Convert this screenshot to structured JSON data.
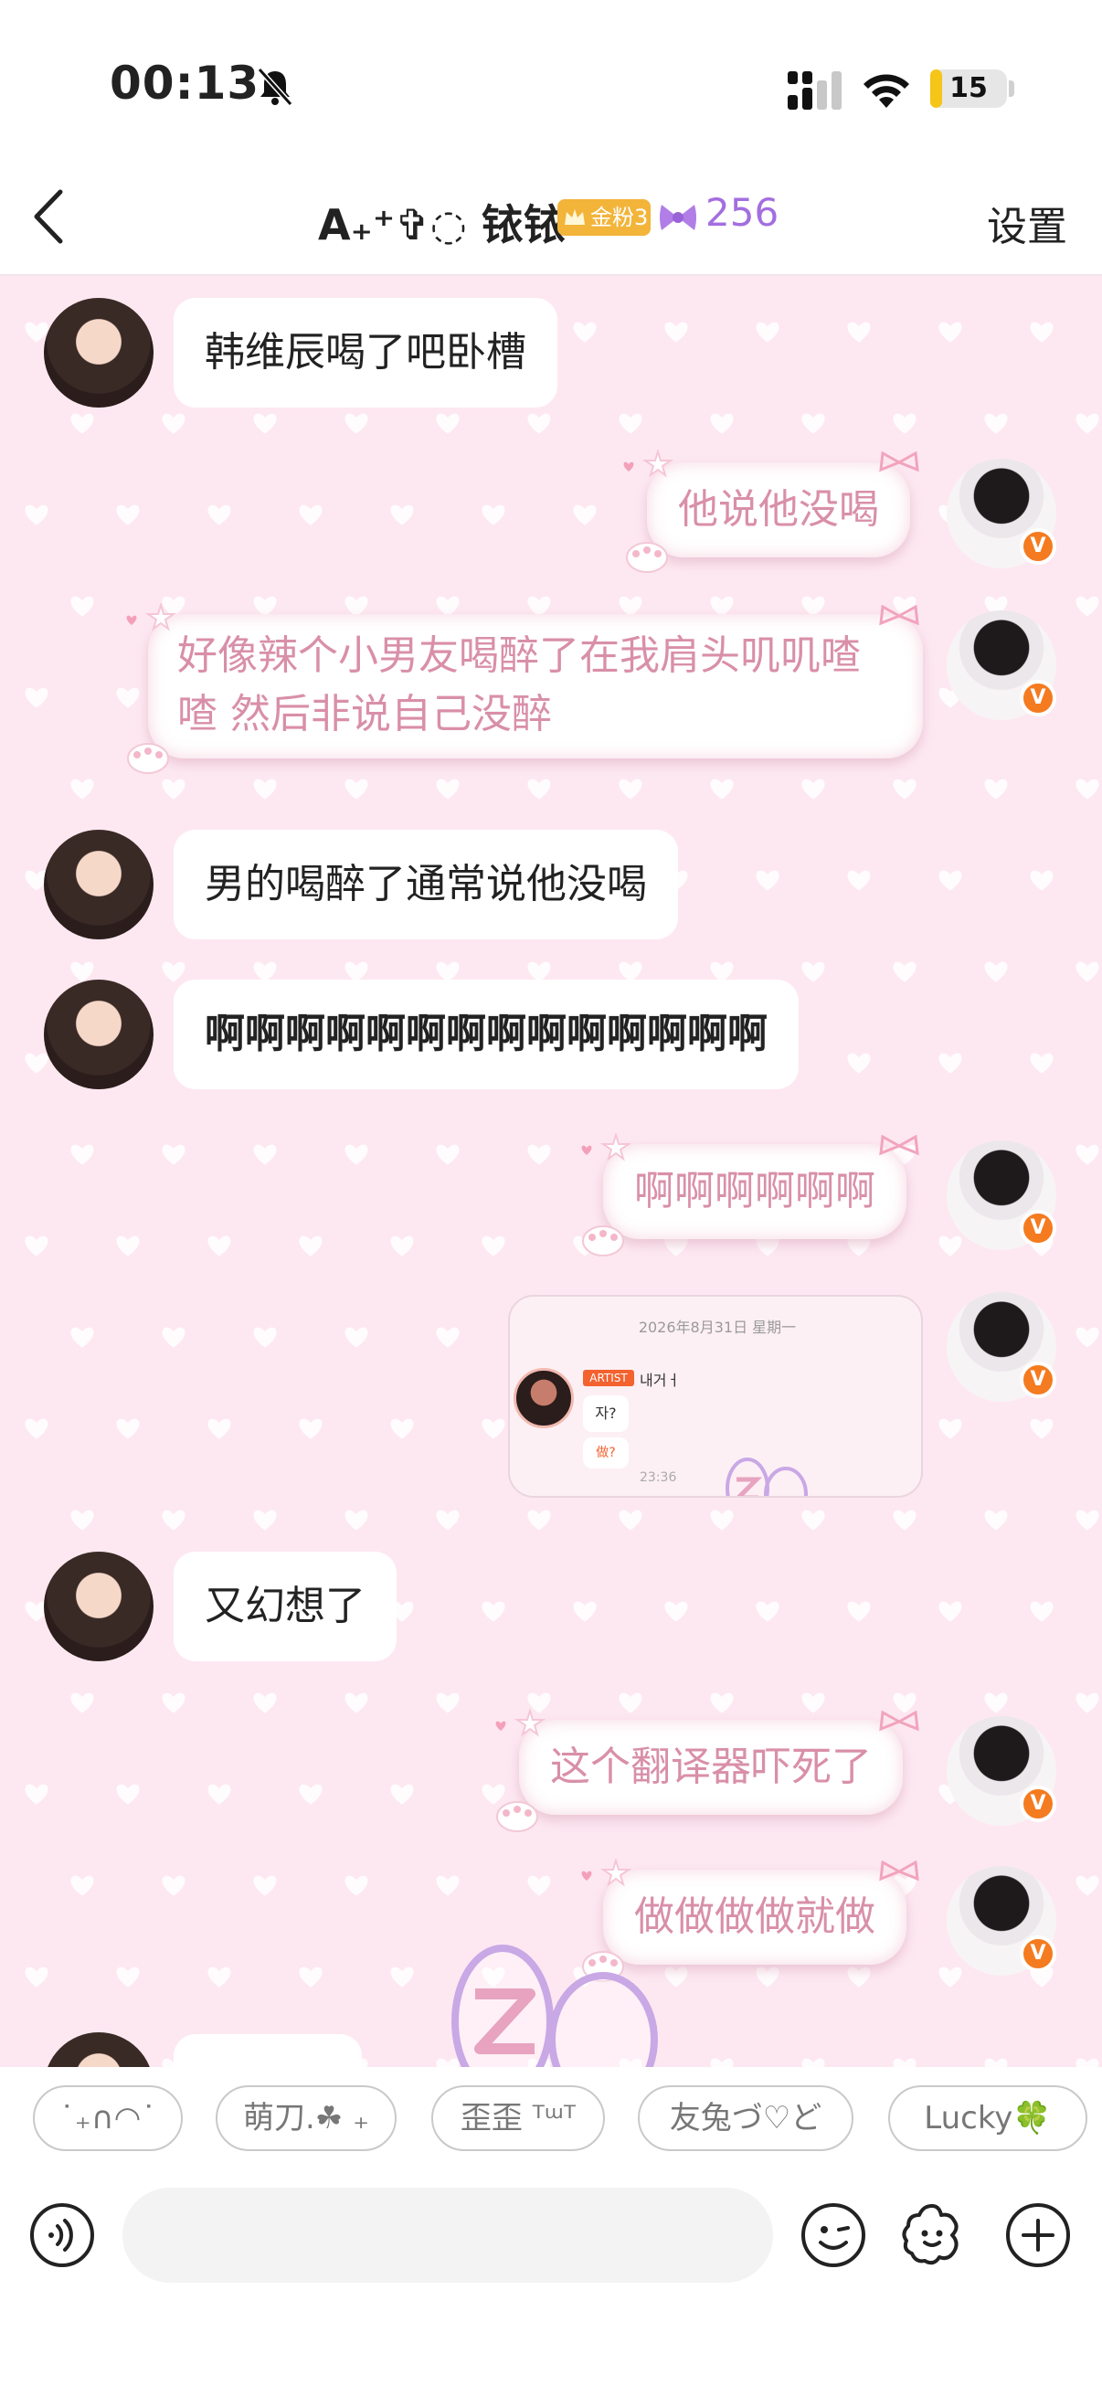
{
  "status_bar": {
    "time": "00:13",
    "battery": "15",
    "battery_level": 0.15,
    "icons": [
      "bell-slash-icon",
      "signal-icon",
      "wifi-icon",
      "battery-icon"
    ]
  },
  "header": {
    "back_icon": "chevron-left-icon",
    "title": "A₊⁺✞◌ 铱铱",
    "fan_badge": "金粉3",
    "fan_icon": "bow-icon",
    "fan_count": "256",
    "settings_label": "设置"
  },
  "messages": [
    {
      "side": "in",
      "text": "韩维辰喝了吧卧槽"
    },
    {
      "side": "out",
      "text": "他说他没喝"
    },
    {
      "side": "out",
      "text": "好像辣个小男友喝醉了在我肩头叽叽喳喳 然后非说自己没醉"
    },
    {
      "side": "in",
      "text": "男的喝醉了通常说他没喝"
    },
    {
      "side": "in",
      "text": "啊啊啊啊啊啊啊啊啊啊啊啊啊啊"
    },
    {
      "side": "out",
      "text": "啊啊啊啊啊啊"
    },
    {
      "side": "out",
      "type": "image"
    },
    {
      "side": "in",
      "text": "又幻想了"
    },
    {
      "side": "out",
      "text": "这个翻译器吓死了"
    },
    {
      "side": "out",
      "text": "做做做做就做"
    }
  ],
  "screenshot": {
    "date": "2026年8月31日 星期一",
    "artist_tag": "ARTIST",
    "name": "내거ㅓ",
    "msg1": "자?",
    "msg2": "做?",
    "time": "23:36"
  },
  "verified_badge": "V",
  "quick_replies": [
    "˙₊∩◠˙",
    "萌刀.☘ ₊",
    "歪歪 ᵀᵚᵀ",
    "友兔づ♡ど",
    "Lucky🍀"
  ],
  "input": {
    "value": "",
    "placeholder": "",
    "icons": [
      "voice-icon",
      "emoji-icon",
      "sticker-icon",
      "plus-icon"
    ]
  },
  "colors": {
    "chat_bg": "#fde8f1",
    "outgoing_text": "#d98fa9",
    "fan_count": "#a36ee0",
    "fan_badge": "#f3b43a",
    "verified": "#f47b20"
  }
}
